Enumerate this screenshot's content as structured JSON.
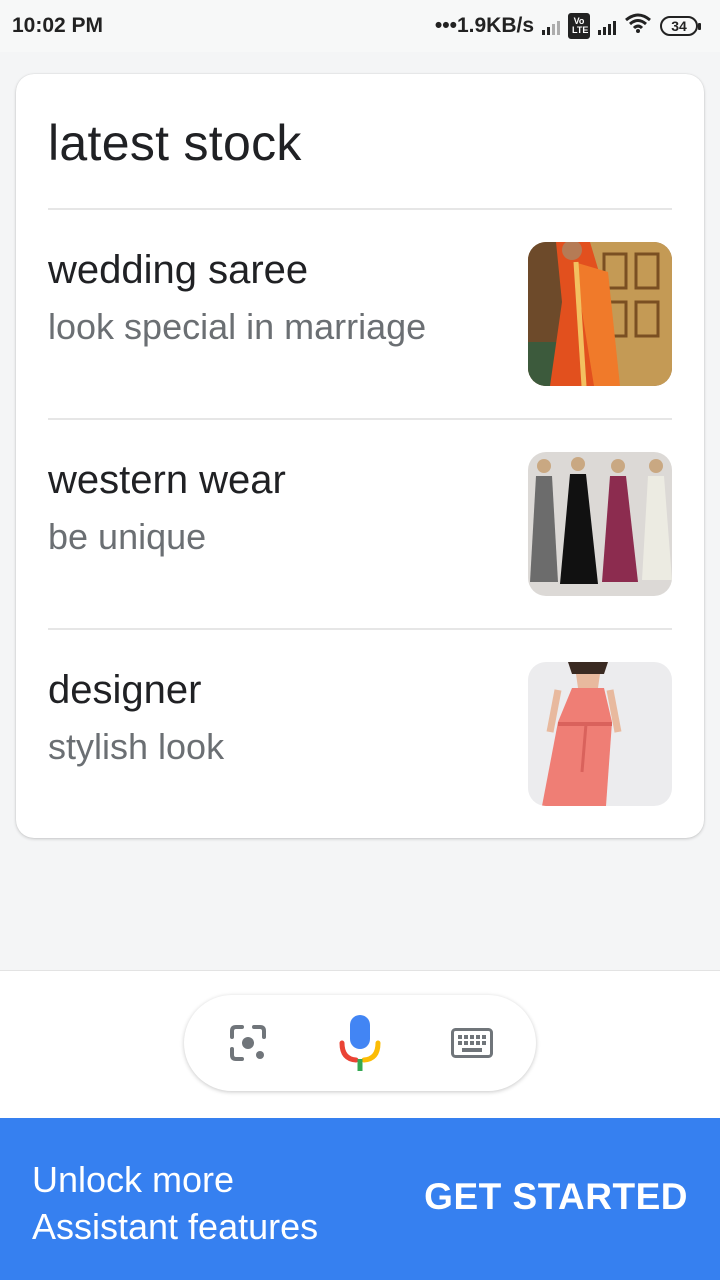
{
  "status_bar": {
    "time": "10:02 PM",
    "network_speed": "•••1.9KB/s",
    "volte_label": "Vo LTE",
    "battery": "34",
    "icons": [
      "signal-icon",
      "volte-icon",
      "signal-icon",
      "wifi-icon",
      "battery-icon"
    ]
  },
  "card": {
    "title": "latest stock",
    "items": [
      {
        "title": "wedding saree",
        "subtitle": "look special in marriage",
        "image": "wedding-saree-image"
      },
      {
        "title": "western wear",
        "subtitle": "be unique",
        "image": "western-wear-image"
      },
      {
        "title": "designer",
        "subtitle": "stylish look",
        "image": "designer-dress-image"
      }
    ]
  },
  "input_bar": {
    "icons": [
      "lens-icon",
      "mic-icon",
      "keyboard-icon"
    ]
  },
  "promo": {
    "line1": "Unlock more",
    "line2": "Assistant features",
    "button": "GET STARTED"
  },
  "colors": {
    "promo_bg": "#3680f0",
    "mic_blue": "#4285f4",
    "mic_red": "#ea4335",
    "mic_yellow": "#fbbc05",
    "mic_green": "#34a853"
  }
}
